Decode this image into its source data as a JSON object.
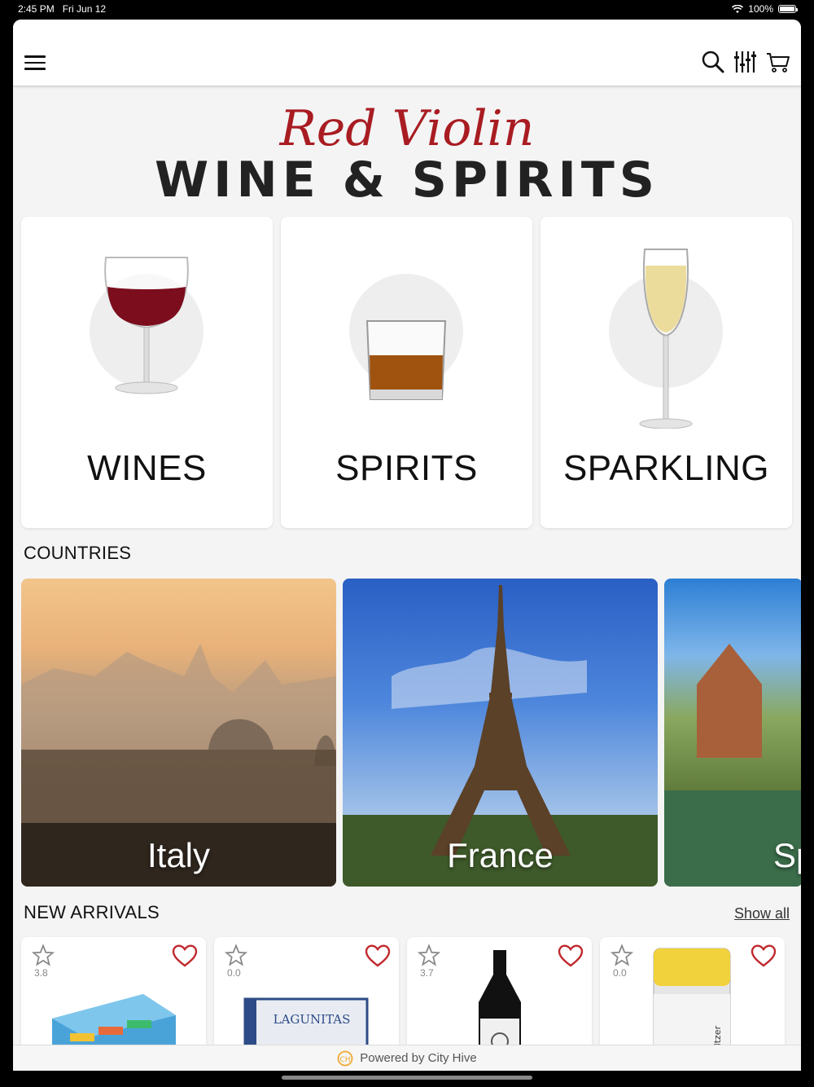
{
  "status": {
    "time": "2:45 PM",
    "date": "Fri Jun 12",
    "battery": "100%"
  },
  "logo": {
    "script_text": "Red Violin",
    "main_text": "WINE & SPIRITS"
  },
  "categories": [
    {
      "label": "WINES",
      "icon": "red-wine-glass-icon"
    },
    {
      "label": "SPIRITS",
      "icon": "whiskey-glass-icon"
    },
    {
      "label": "SPARKLING",
      "icon": "champagne-flute-icon"
    }
  ],
  "countries_section": {
    "title": "COUNTRIES"
  },
  "countries": [
    {
      "label": "Italy"
    },
    {
      "label": "France"
    },
    {
      "label": "Sp"
    }
  ],
  "arrivals_section": {
    "title": "NEW ARRIVALS",
    "show_all": "Show all"
  },
  "products": [
    {
      "rating": "3.8"
    },
    {
      "rating": "0.0",
      "brand_text": "LAGUNITAS"
    },
    {
      "rating": "3.7"
    },
    {
      "rating": "0.0",
      "can_text": "Seltzer"
    }
  ],
  "footer": {
    "text": "Powered by City Hive"
  },
  "colors": {
    "heart": "#c0282d",
    "logo_red": "#a81c22",
    "logo_dark": "#222222"
  }
}
